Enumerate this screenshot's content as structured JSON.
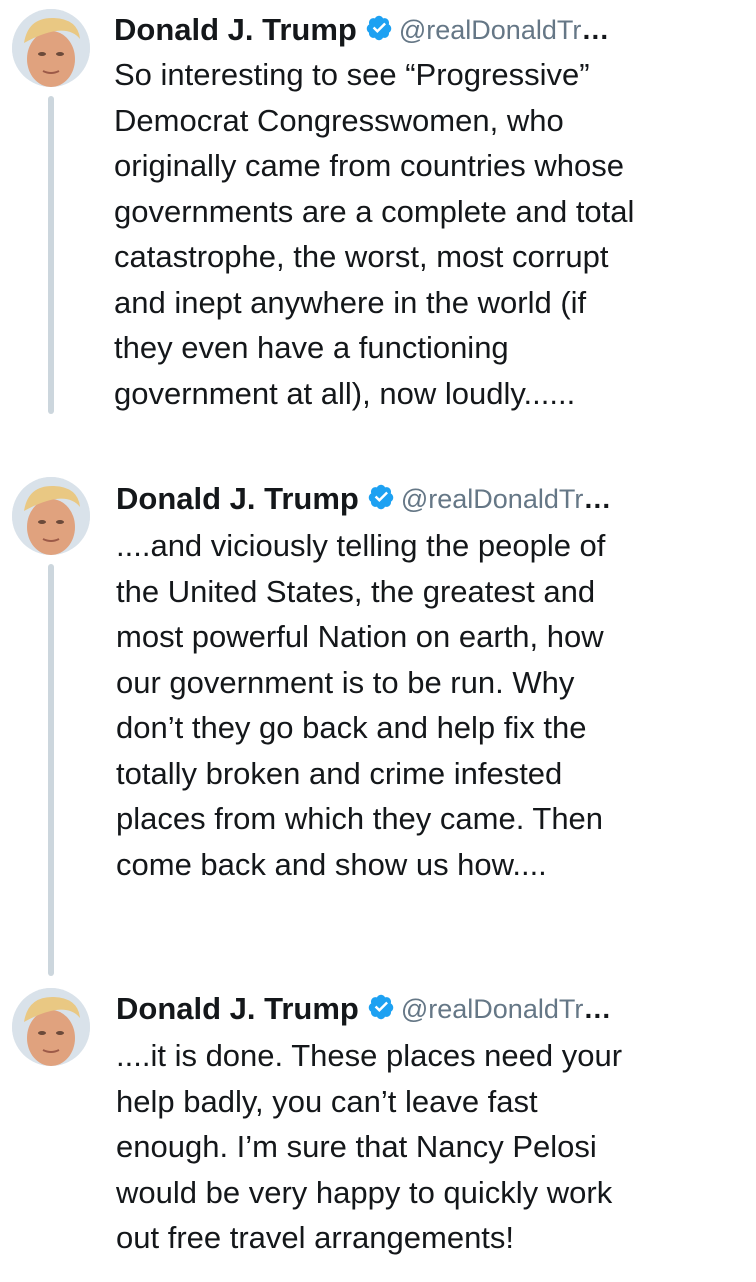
{
  "thread": {
    "tweets": [
      {
        "author": {
          "name": "Donald J. Trump",
          "handle": "@realDonaldTr",
          "verified": true,
          "avatar": "profile-photo"
        },
        "truncation": "…",
        "text": "So interesting to see “Progressive”\nDemocrat Congresswomen, who\noriginally came from countries whose\ngovernments are a complete and total\ncatastrophe, the worst, most corrupt\nand inept anywhere in the world (if\nthey even have a functioning\ngovernment at all), now loudly......"
      },
      {
        "author": {
          "name": "Donald J. Trump",
          "handle": "@realDonaldTr",
          "verified": true,
          "avatar": "profile-photo"
        },
        "truncation": "…",
        "text": "....and viciously telling the people of\nthe United States, the greatest and\nmost powerful Nation on earth, how\nour government is to be run. Why\ndon’t they go back and help fix the\ntotally broken and crime infested\nplaces from which they came. Then\ncome back and show us how...."
      },
      {
        "author": {
          "name": "Donald J. Trump",
          "handle": "@realDonaldTr",
          "verified": true,
          "avatar": "profile-photo"
        },
        "truncation": "…",
        "text": "....it is done. These places need your\nhelp badly, you can’t leave fast\nenough. I’m sure that Nancy Pelosi\nwould be very happy to quickly work\nout free travel arrangements!"
      }
    ]
  },
  "colors": {
    "text": "#14171a",
    "handle": "#657786",
    "verified_badge": "#1da1f2",
    "thread_line": "#ccd6dd"
  },
  "icons": {
    "verified": "verified-badge-icon"
  }
}
